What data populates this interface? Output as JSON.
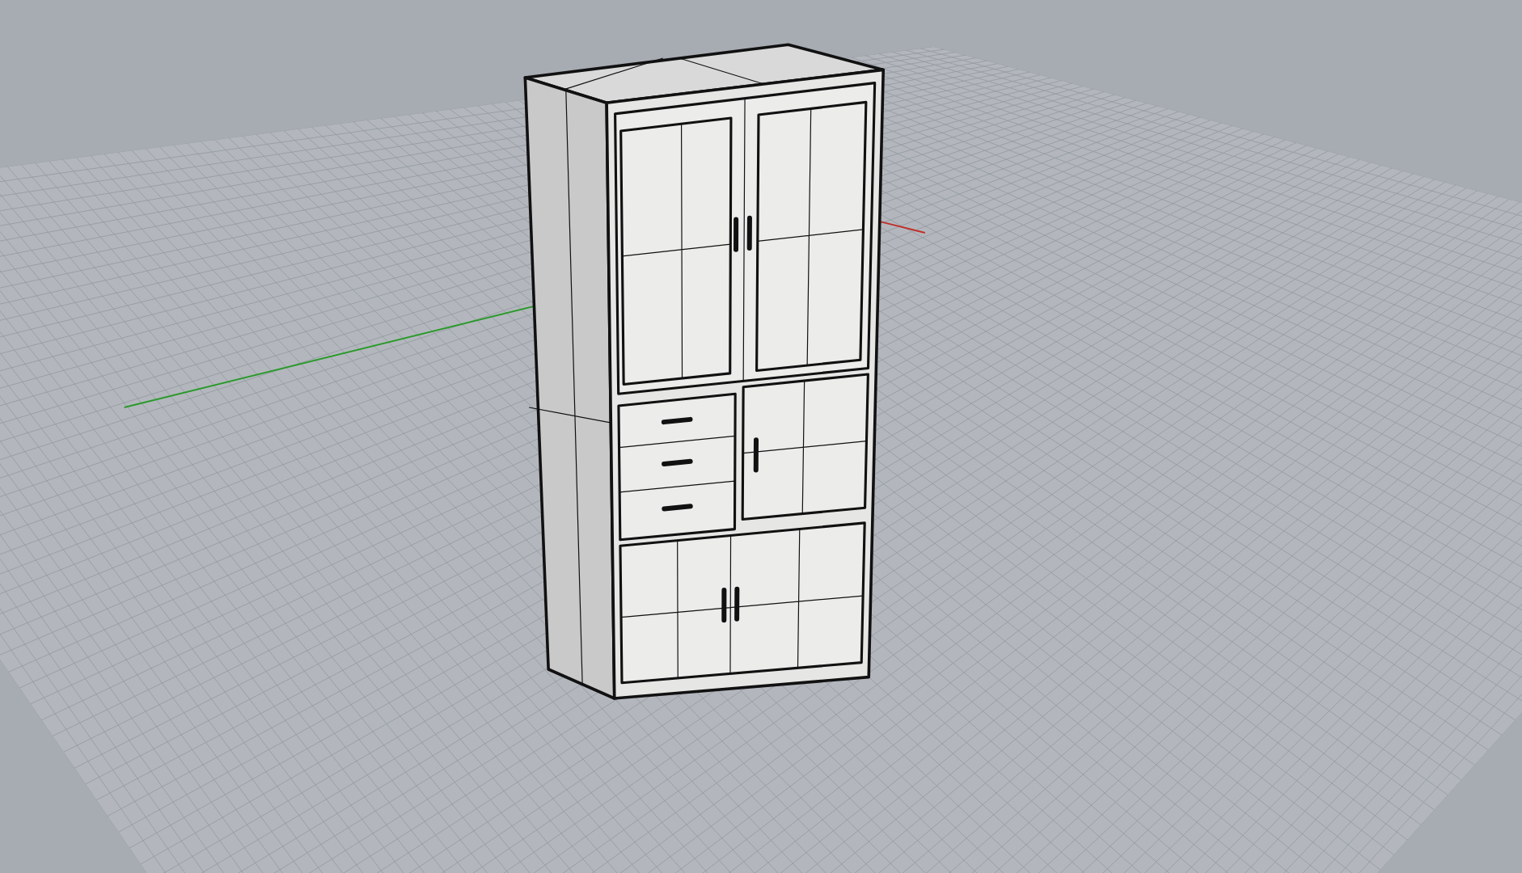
{
  "viewport": {
    "grid": true,
    "world_axes": true
  }
}
